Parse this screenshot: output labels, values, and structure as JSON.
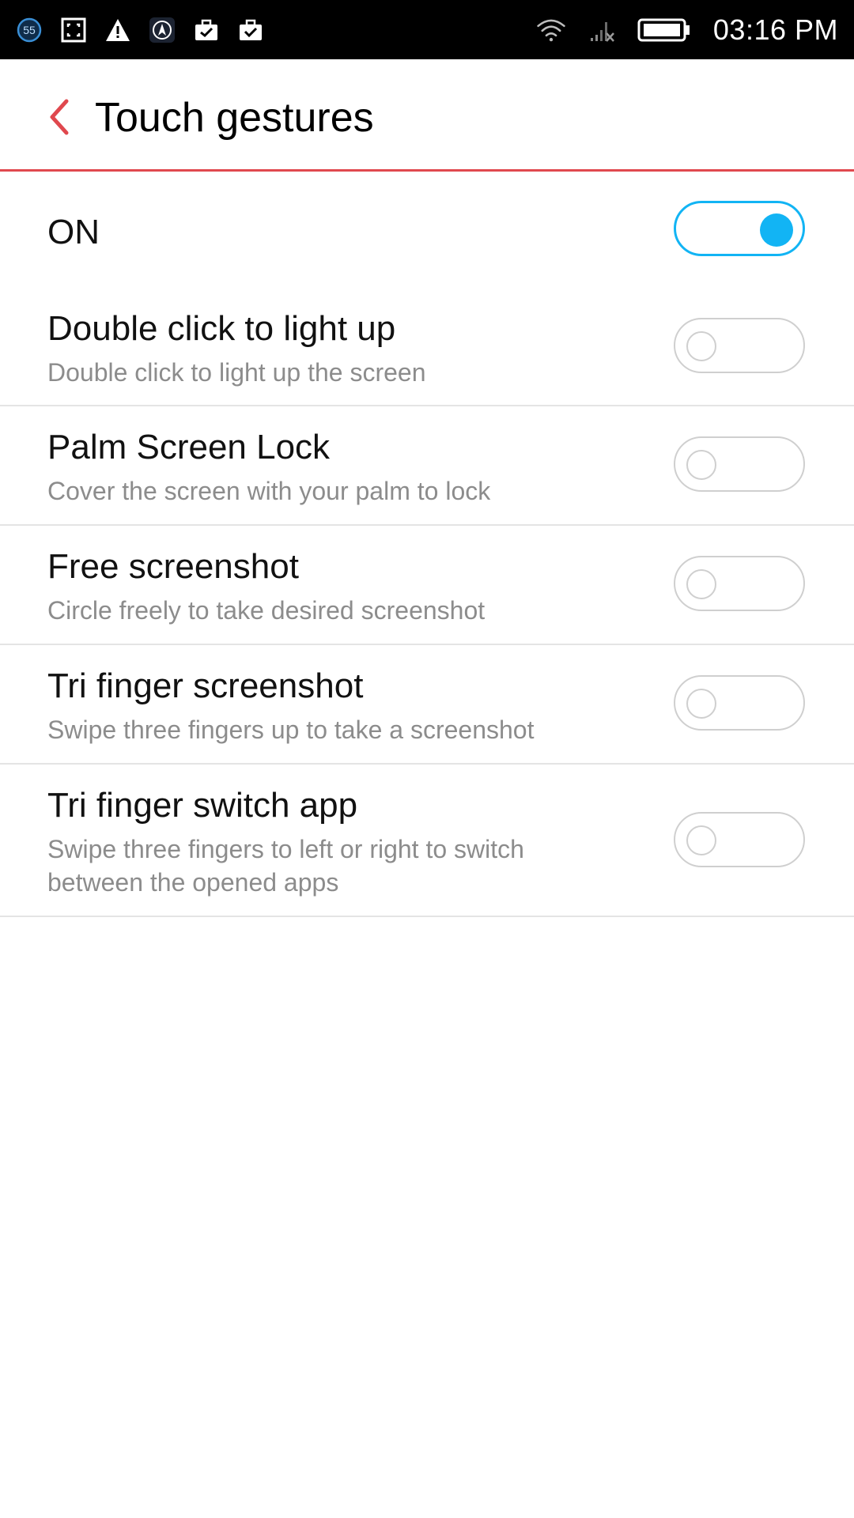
{
  "status_bar": {
    "notification_count": "55",
    "time": "03:16 PM",
    "icons": [
      "badge-55-icon",
      "screenshot-frame-icon",
      "warning-icon",
      "navigation-app-icon",
      "briefcase-icon",
      "briefcase-check-icon",
      "wifi-icon",
      "signal-no-sim-icon",
      "battery-icon"
    ]
  },
  "header": {
    "back_icon": "chevron-left-icon",
    "title": "Touch gestures"
  },
  "colors": {
    "accent_red": "#e0484e",
    "toggle_on": "#12b4f4",
    "subtitle_gray": "#8c8c8c"
  },
  "master": {
    "label": "ON",
    "enabled": true
  },
  "settings": [
    {
      "title": "Double click to light up",
      "subtitle": "Double click to light up the screen",
      "enabled": false
    },
    {
      "title": "Palm Screen Lock",
      "subtitle": "Cover the screen with your palm to lock",
      "enabled": false
    },
    {
      "title": "Free screenshot",
      "subtitle": "Circle freely to take desired screenshot",
      "enabled": false
    },
    {
      "title": "Tri finger screenshot",
      "subtitle": "Swipe three fingers up to take a screenshot",
      "enabled": false
    },
    {
      "title": "Tri finger switch app",
      "subtitle": "Swipe three fingers to left or right to switch between the opened apps",
      "enabled": false
    }
  ]
}
